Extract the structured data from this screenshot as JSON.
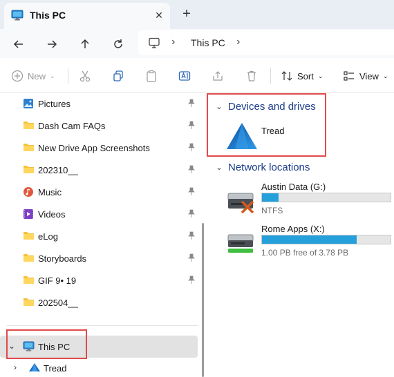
{
  "window": {
    "tab_title": "This PC",
    "tab_close": "✕",
    "new_tab": "+"
  },
  "address": {
    "location": "This PC",
    "separator": "›"
  },
  "commands": {
    "new_label": "New",
    "sort_label": "Sort",
    "view_label": "View"
  },
  "nav": {
    "items": [
      {
        "label": "Pictures",
        "icon": "pictures-icon",
        "pinned": true
      },
      {
        "label": "Dash Cam FAQs",
        "icon": "folder-icon",
        "pinned": true
      },
      {
        "label": "New Drive App Screenshots",
        "icon": "folder-icon",
        "pinned": true
      },
      {
        "label": "202310__",
        "icon": "folder-icon",
        "pinned": true
      },
      {
        "label": "Music",
        "icon": "music-icon",
        "pinned": true
      },
      {
        "label": "Videos",
        "icon": "videos-icon",
        "pinned": true
      },
      {
        "label": "eLog",
        "icon": "folder-icon",
        "pinned": true
      },
      {
        "label": "Storyboards",
        "icon": "folder-icon",
        "pinned": true
      },
      {
        "label": "GIF 9• 19",
        "icon": "folder-icon",
        "pinned": true
      },
      {
        "label": "202504__",
        "icon": "folder-icon",
        "pinned": false
      }
    ],
    "this_pc": "This PC",
    "tread": "Tread"
  },
  "content": {
    "devices_header": "Devices and drives",
    "network_header": "Network locations",
    "devices": [
      {
        "name": "Tread"
      }
    ],
    "network": [
      {
        "name": "Austin Data (G:)",
        "detail": "NTFS",
        "used_fraction": 0.13,
        "status": "disconnected"
      },
      {
        "name": "Rome Apps (X:)",
        "detail": "1.00 PB free of 3.78 PB",
        "used_fraction": 0.735,
        "status": "connected"
      }
    ]
  },
  "colors": {
    "accent": "#26a0da",
    "highlight_box": "#e24a4a",
    "header_text": "#1b3c8a"
  }
}
